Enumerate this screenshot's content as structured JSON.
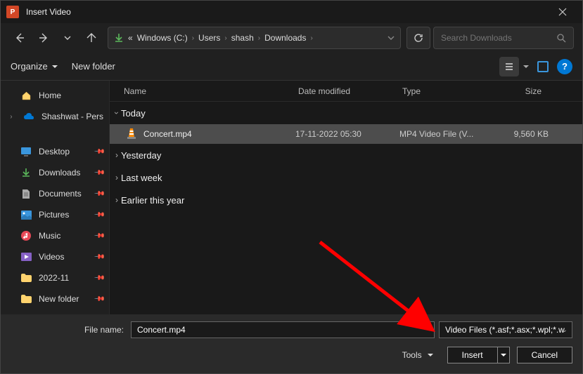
{
  "titlebar": {
    "title": "Insert Video"
  },
  "breadcrumb": {
    "prefix": "«",
    "items": [
      "Windows (C:)",
      "Users",
      "shash",
      "Downloads"
    ]
  },
  "search": {
    "placeholder": "Search Downloads"
  },
  "toolbar": {
    "organize": "Organize",
    "new_folder": "New folder"
  },
  "sidebar": {
    "home": "Home",
    "onedrive": "Shashwat - Pers",
    "quick": [
      {
        "label": "Desktop",
        "icon": "desktop"
      },
      {
        "label": "Downloads",
        "icon": "downloads"
      },
      {
        "label": "Documents",
        "icon": "documents"
      },
      {
        "label": "Pictures",
        "icon": "pictures"
      },
      {
        "label": "Music",
        "icon": "music"
      },
      {
        "label": "Videos",
        "icon": "videos"
      },
      {
        "label": "2022-11",
        "icon": "folder"
      },
      {
        "label": "New folder",
        "icon": "folder"
      }
    ]
  },
  "columns": {
    "name": "Name",
    "date": "Date modified",
    "type": "Type",
    "size": "Size"
  },
  "groups": [
    {
      "label": "Today",
      "expanded": true,
      "files": [
        {
          "name": "Concert.mp4",
          "date": "17-11-2022 05:30",
          "type": "MP4 Video File (V...",
          "size": "9,560 KB",
          "selected": true
        }
      ]
    },
    {
      "label": "Yesterday",
      "expanded": false,
      "files": []
    },
    {
      "label": "Last week",
      "expanded": false,
      "files": []
    },
    {
      "label": "Earlier this year",
      "expanded": false,
      "files": []
    }
  ],
  "bottom": {
    "filename_label": "File name:",
    "filename_value": "Concert.mp4",
    "filter": "Video Files (*.asf;*.asx;*.wpl;*.w",
    "tools": "Tools",
    "insert": "Insert",
    "cancel": "Cancel"
  }
}
